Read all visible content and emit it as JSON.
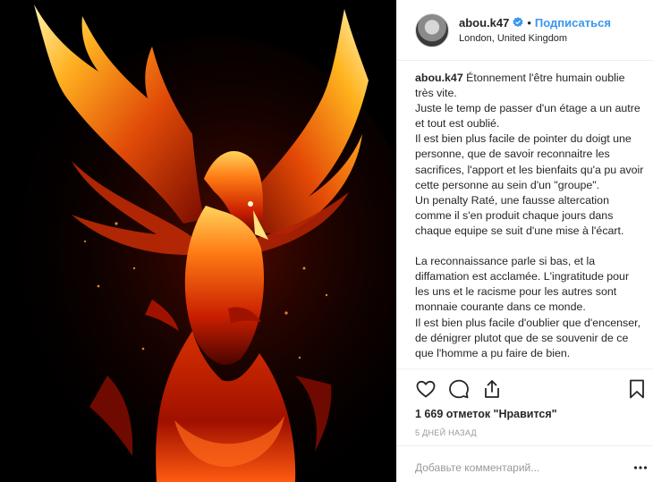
{
  "post": {
    "username": "abou.k47",
    "separator": "•",
    "follow_label": "Подписаться",
    "location": "London, United Kingdom",
    "caption_username": "abou.k47",
    "caption_lines": [
      "Étonnement l'être humain oublie très vite.",
      "Juste le temp de passer d'un étage a un autre et tout est oublié.",
      "Il est bien plus facile de pointer du doigt une personne, que de savoir reconnaitre les sacrifices, l'apport et les bienfaits qu'a pu avoir cette personne au sein d'un \"groupe\".",
      "Un penalty Raté, une fausse altercation comme il s'en produit chaque jours dans chaque equipe se suit d'une mise à l'écart.",
      "La reconnaissance parle si bas, et la diffamation est acclamée. L'ingratitude pour les uns et le racisme pour les autres sont monnaie courante dans ce monde.",
      "Il est bien plus facile d'oublier que d'encenser, de dénigrer plutot que de se souvenir de ce que l'homme a pu faire de bien."
    ],
    "likes": "1 669 отметок \"Нравится\"",
    "time": "5 ДНЕЙ НАЗАД",
    "comment_placeholder": "Добавьте комментарий...",
    "icons": {
      "like": "heart-icon",
      "comment": "comment-icon",
      "share": "share-icon",
      "save": "bookmark-icon",
      "verified": "verified-badge-icon",
      "more": "ellipsis-icon"
    },
    "colors": {
      "accent": "#3897f0",
      "text": "#262626",
      "muted": "#999999",
      "divider": "#efefef"
    }
  }
}
